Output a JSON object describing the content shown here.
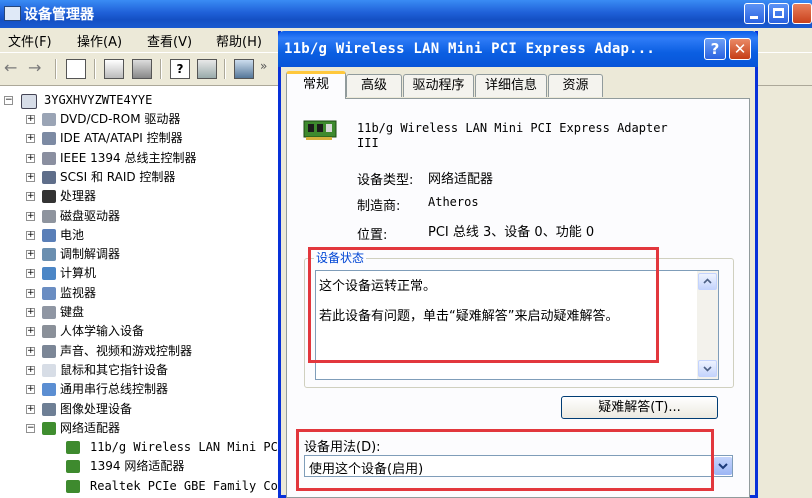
{
  "devmgr": {
    "title": "设备管理器",
    "menu": [
      "文件(F)",
      "操作(A)",
      "查看(V)",
      "帮助(H)"
    ],
    "tree": {
      "root": "3YGXHVYZWTE4YYE",
      "categories": [
        {
          "label": "DVD/CD-ROM 驱动器",
          "icon": "dvd-drive-icon",
          "expanded": false
        },
        {
          "label": "IDE ATA/ATAPI 控制器",
          "icon": "ide-controller-icon",
          "expanded": false
        },
        {
          "label": "IEEE 1394 总线主控制器",
          "icon": "ieee1394-icon",
          "expanded": false
        },
        {
          "label": "SCSI 和 RAID 控制器",
          "icon": "scsi-icon",
          "expanded": false
        },
        {
          "label": "处理器",
          "icon": "processor-icon",
          "expanded": false
        },
        {
          "label": "磁盘驱动器",
          "icon": "disk-drive-icon",
          "expanded": false
        },
        {
          "label": "电池",
          "icon": "battery-icon",
          "expanded": false
        },
        {
          "label": "调制解调器",
          "icon": "modem-icon",
          "expanded": false
        },
        {
          "label": "计算机",
          "icon": "computer-icon",
          "expanded": false
        },
        {
          "label": "监视器",
          "icon": "monitor-icon",
          "expanded": false
        },
        {
          "label": "键盘",
          "icon": "keyboard-icon",
          "expanded": false
        },
        {
          "label": "人体学输入设备",
          "icon": "hid-icon",
          "expanded": false
        },
        {
          "label": "声音、视频和游戏控制器",
          "icon": "sound-icon",
          "expanded": false
        },
        {
          "label": "鼠标和其它指针设备",
          "icon": "mouse-icon",
          "expanded": false
        },
        {
          "label": "通用串行总线控制器",
          "icon": "usb-icon",
          "expanded": false
        },
        {
          "label": "图像处理设备",
          "icon": "camera-icon",
          "expanded": false
        },
        {
          "label": "网络适配器",
          "icon": "network-adapter-icon",
          "expanded": true
        }
      ],
      "network_children": [
        "11b/g Wireless LAN Mini PC",
        "1394 网络适配器",
        "Realtek PCIe GBE Family Co"
      ]
    }
  },
  "dialog": {
    "title": "11b/g Wireless LAN Mini PCI Express Adap...",
    "tabs": [
      "常规",
      "高级",
      "驱动程序",
      "详细信息",
      "资源"
    ],
    "active_tab": "常规",
    "device_name": [
      "11b/g Wireless LAN Mini PCI Express Adapter",
      "III"
    ],
    "props": {
      "type_label": "设备类型:",
      "type_value": "网络适配器",
      "mfr_label": "制造商:",
      "mfr_value": "Atheros",
      "loc_label": "位置:",
      "loc_value": "PCI 总线 3、设备 0、功能 0"
    },
    "status_group_title": "设备状态",
    "status_lines": [
      "这个设备运转正常。",
      "若此设备有问题，单击“疑难解答”来启动疑难解答。"
    ],
    "troubleshoot_button": "疑难解答(T)...",
    "usage_label": "设备用法(D):",
    "usage_value": "使用这个设备(启用)"
  },
  "colors": {
    "xp_title_blue": "#0a5ce8",
    "highlight_red": "#e2373d",
    "group_title_blue": "#0046d5",
    "tab_active_accent": "#ffc83c"
  }
}
